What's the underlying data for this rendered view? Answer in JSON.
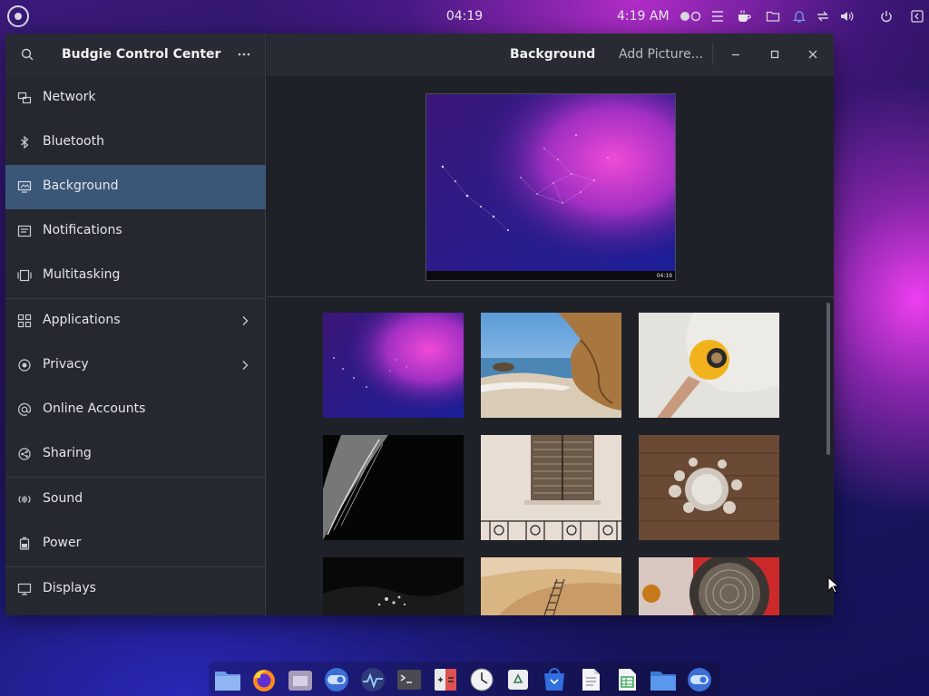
{
  "panel": {
    "center_clock": "04:19",
    "time": "4:19 AM",
    "tray_icons": [
      "toggle-icon",
      "menu-icon",
      "coffee-icon",
      "folder-icon",
      "bell-icon",
      "network-icon",
      "volume-icon",
      "power-icon",
      "panel-icon"
    ]
  },
  "window": {
    "app_title": "Budgie Control Center",
    "page_title": "Background",
    "add_picture_label": "Add Picture..."
  },
  "sidebar": {
    "items": [
      {
        "label": "Network",
        "icon": "network-icon"
      },
      {
        "label": "Bluetooth",
        "icon": "bluetooth-icon"
      },
      {
        "label": "Background",
        "icon": "background-icon",
        "active": true
      },
      {
        "label": "Notifications",
        "icon": "notifications-icon"
      },
      {
        "label": "Multitasking",
        "icon": "multitasking-icon"
      },
      {
        "label": "Applications",
        "icon": "applications-icon",
        "has_arrow": true
      },
      {
        "label": "Privacy",
        "icon": "privacy-icon",
        "has_arrow": true
      },
      {
        "label": "Online Accounts",
        "icon": "online-accounts-icon"
      },
      {
        "label": "Sharing",
        "icon": "sharing-icon"
      },
      {
        "label": "Sound",
        "icon": "sound-icon"
      },
      {
        "label": "Power",
        "icon": "power-icon"
      },
      {
        "label": "Displays",
        "icon": "displays-icon"
      }
    ]
  },
  "preview": {
    "clock": "04:19"
  },
  "wallpapers": [
    "constellation-wallpaper",
    "beach-rock-wallpaper",
    "hand-fruit-wallpaper",
    "monochrome-leaf-wallpaper",
    "window-shutter-wallpaper",
    "flowers-jar-wallpaper",
    "dark-water-wallpaper",
    "wooden-ladder-wallpaper",
    "bowl-spice-wallpaper"
  ],
  "dock": {
    "apps": [
      "file-manager",
      "firefox",
      "files",
      "budgie-toggle",
      "system-monitor",
      "terminal",
      "calculator",
      "clock",
      "recycle",
      "store",
      "text-editor",
      "spreadsheet",
      "folder",
      "control-center"
    ]
  },
  "colors": {
    "accent": "#3b5778",
    "window_bg": "#21232b",
    "header_bg": "#282b34"
  }
}
